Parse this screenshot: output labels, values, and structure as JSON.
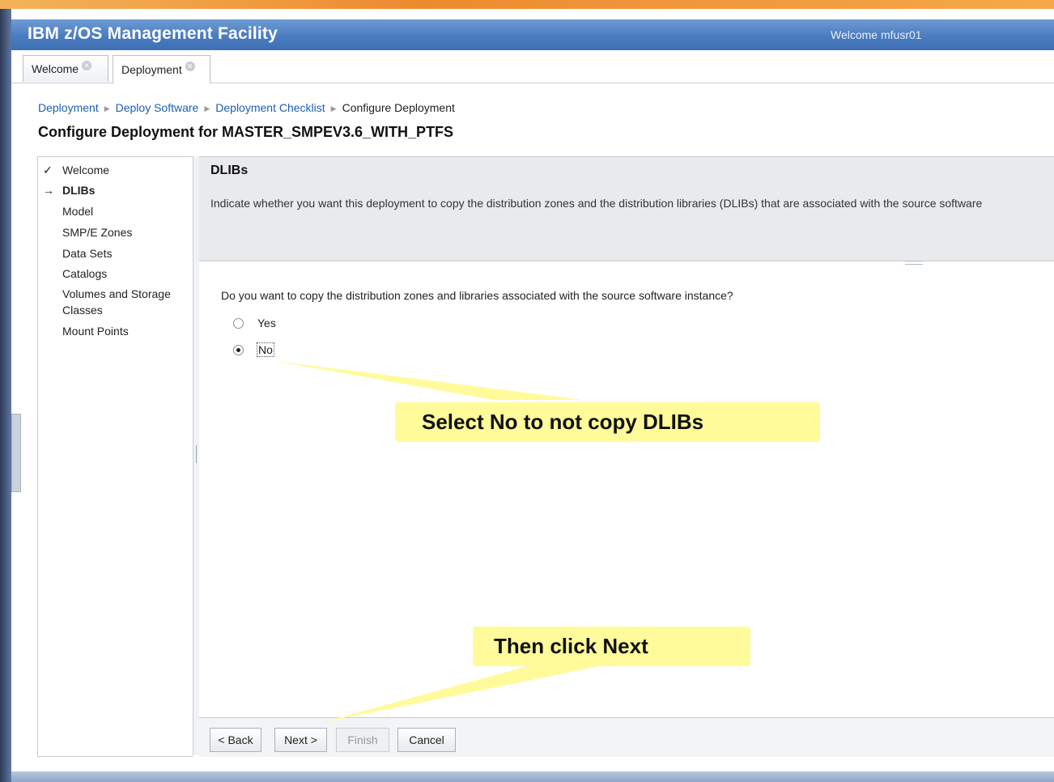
{
  "app": {
    "title": "IBM z/OS Management Facility",
    "welcome": "Welcome mfusr01"
  },
  "tabs": [
    {
      "label": "Welcome"
    },
    {
      "label": "Deployment"
    }
  ],
  "breadcrumb": {
    "items": [
      "Deployment",
      "Deploy Software",
      "Deployment Checklist"
    ],
    "current": "Configure Deployment"
  },
  "page": {
    "title": "Configure Deployment for MASTER_SMPEV3.6_WITH_PTFS"
  },
  "wizard_nav": {
    "items": [
      "Welcome",
      "DLIBs",
      "Model",
      "SMP/E Zones",
      "Data Sets",
      "Catalogs",
      "Volumes and Storage",
      "Classes",
      "Mount Points"
    ],
    "completed_mark": "✓",
    "current_mark": "→"
  },
  "panel": {
    "title": "DLIBs",
    "description": "Indicate whether you want this deployment to copy the distribution zones and the distribution libraries (DLIBs) that are associated with the source software",
    "question": "Do you want to copy the distribution zones and libraries associated with the source software instance?",
    "options": [
      {
        "label": "Yes",
        "selected": false
      },
      {
        "label": "No",
        "selected": true
      }
    ]
  },
  "buttons": {
    "back": "< Back",
    "next": "Next >",
    "finish": "Finish",
    "cancel": "Cancel"
  },
  "callouts": {
    "select_no": "Select No to not copy DLIBs",
    "click_next": "Then click Next"
  },
  "colors": {
    "header": "#4a7cc0",
    "link": "#1b5fb0",
    "callout": "#fffb9a",
    "accent_band": "#ee8a2e"
  }
}
